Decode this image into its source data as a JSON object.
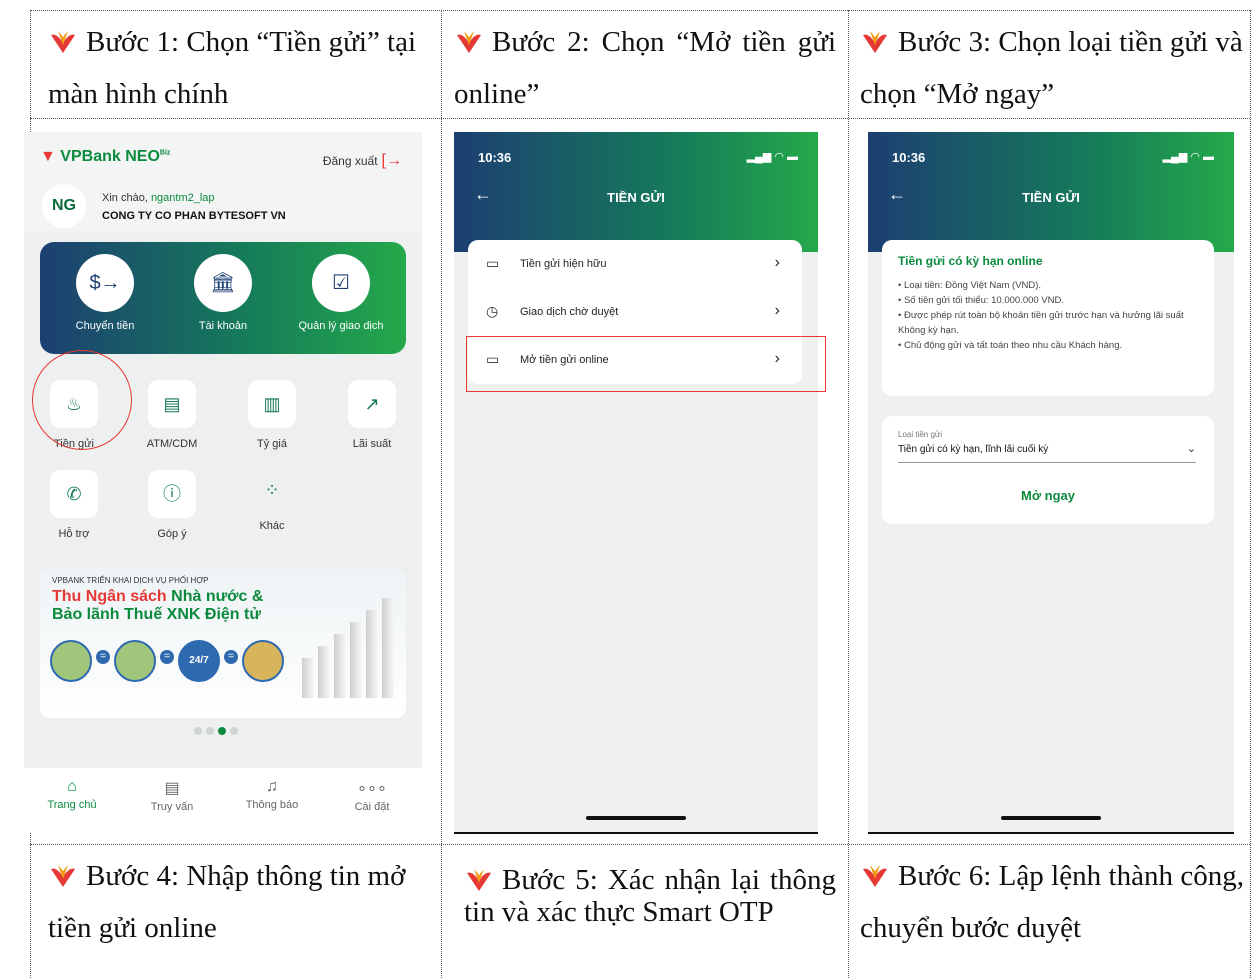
{
  "steps": {
    "s1": "Bước 1: Chọn “Tiền gửi” tại màn hình chính",
    "s2": "Bước 2: Chọn “Mở tiền gửi online”",
    "s3": "Bước 3: Chọn loại tiền gửi và chọn “Mở ngay”",
    "s4": "Bước 4: Nhập thông tin mở tiền gửi online",
    "s5": "Bước 5: Xác nhận lại thông tin và xác thực Smart OTP",
    "s6": "Bước 6: Lập lệnh thành công, chuyển bước duyệt"
  },
  "screen1": {
    "logo": "VPBank NEO",
    "logo_sup": "Biz",
    "logout": "Đăng xuất",
    "avatar": "NG",
    "greeting": "Xin chào,",
    "username": "ngantm2_lap",
    "company": "CONG TY CO PHAN BYTESOFT VN",
    "quick_actions": [
      "Chuyển tiền",
      "Tài khoản",
      "Quản lý giao dịch"
    ],
    "grid": [
      "Tiền gửi",
      "ATM/CDM",
      "Tỷ giá",
      "Lãi suất",
      "Hỗ trợ",
      "Góp ý",
      "Khác"
    ],
    "banner_small": "VPBANK TRIỂN KHAI DỊCH VỤ PHỐI HỢP",
    "banner_red": "Thu Ngân sách",
    "banner_green1": "Nhà nước &",
    "banner_green2": "Bảo lãnh Thuế XNK Điện tử",
    "banner_247": "24/7",
    "nav": [
      "Trang chủ",
      "Truy vấn",
      "Thông báo",
      "Cài đặt"
    ]
  },
  "screen2": {
    "time": "10:36",
    "title": "TIỀN GỬI",
    "items": [
      "Tiền gửi hiện hữu",
      "Giao dịch chờ duyệt",
      "Mở tiền gửi online"
    ]
  },
  "screen3": {
    "time": "10:36",
    "title": "TIỀN GỬI",
    "card_title": "Tiền gửi có kỳ hạn online",
    "bullets": [
      "• Loại tiền: Đồng Việt Nam (VND).",
      "• Số tiền gửi tối thiểu: 10.000.000 VND.",
      "• Được phép rút toàn bộ khoản tiền gửi trước hạn và hưởng lãi suất Không kỳ hạn.",
      "• Chủ động gửi và tất toán theo nhu cầu Khách hàng."
    ],
    "field_label": "Loại tiền gửi",
    "field_value": "Tiền gửi có kỳ hạn, lĩnh lãi cuối kỳ",
    "open_button": "Mở ngay"
  },
  "icons": {
    "bullet": "vpbank-bullet-icon",
    "bullet_color": "#e53935",
    "accent_green": "#0b8a3d",
    "accent_navy": "#1d3f72"
  }
}
